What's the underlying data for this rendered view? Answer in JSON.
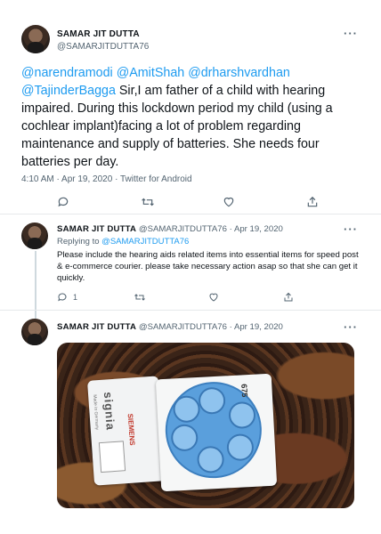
{
  "tweet": {
    "author_name": "SAMAR JIT DUTTA",
    "author_handle": "@SAMARJITDUTTA76",
    "more_label": "···",
    "text_mentions": [
      "@narendramodi",
      "@AmitShah",
      "@drharshvardhan",
      "@TajinderBagga"
    ],
    "text_body": " Sir,I am father of a child with hearing impaired. During this lockdown period my child  (using a cochlear implant)facing a lot of problem regarding maintenance and supply of batteries. She needs four batteries per day.",
    "meta": "4:10 AM · Apr 19, 2020 · Twitter for Android"
  },
  "reply1": {
    "author_name": "SAMAR JIT DUTTA",
    "author_handle_date": "@SAMARJITDUTTA76 · Apr 19, 2020",
    "replying_prefix": "Replying to ",
    "replying_handle": "@SAMARJITDUTTA76",
    "text": "Please include the hearing aids related items into essential items for speed post & e-commerce courier. please take necessary action asap so that she can get it quickly.",
    "reply_count": "1",
    "more_label": "···"
  },
  "reply2": {
    "author_name": "SAMAR JIT DUTTA",
    "author_handle_date": "@SAMARJITDUTTA76 · Apr 19, 2020",
    "more_label": "···",
    "media": {
      "brand": "signia",
      "sub": "Made in Germany",
      "logo": "SIEMENS",
      "size": "675"
    }
  },
  "colors": {
    "link": "#1d9bf0",
    "secondary_text": "#536471"
  },
  "icons": {
    "reply": "reply-icon",
    "retweet": "retweet-icon",
    "like": "like-icon",
    "share": "share-icon"
  }
}
